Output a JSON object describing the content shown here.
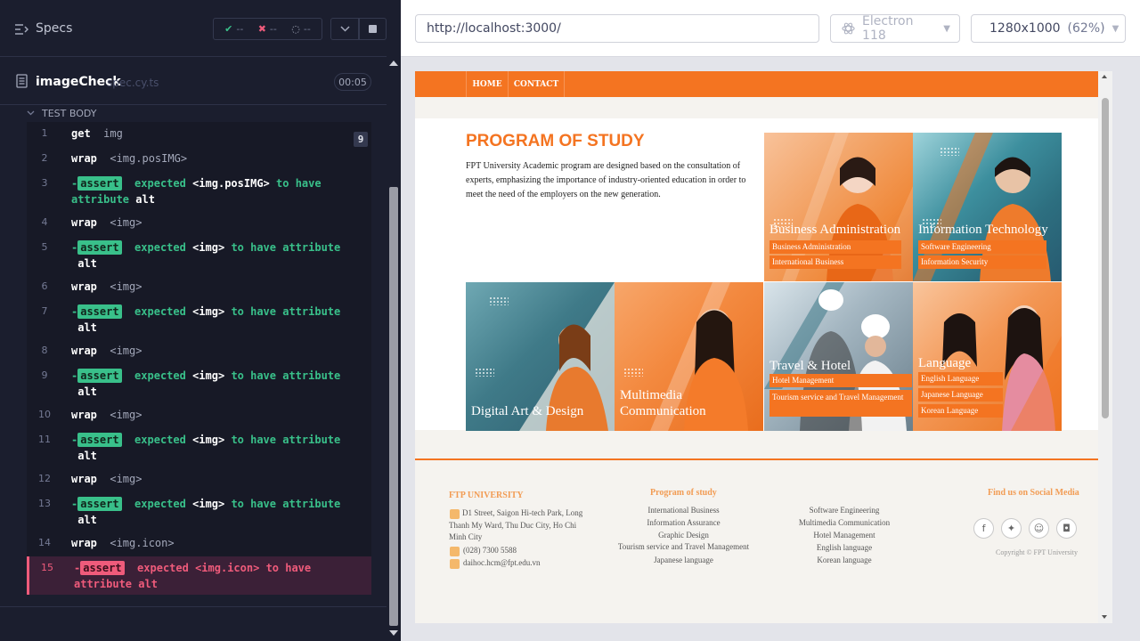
{
  "reporter": {
    "specs_label": "Specs",
    "stats": {
      "passed": "--",
      "failed": "--",
      "pending": "--"
    },
    "file_name": "imageCheck",
    "file_ext": "spec.cy.ts",
    "timer": "00:05",
    "test_body": "TEST BODY",
    "badge": "9",
    "commands": [
      {
        "n": "1",
        "kw": "get",
        "arg": "img"
      },
      {
        "n": "2",
        "kw": "wrap",
        "arg": "<img.posIMG>"
      },
      {
        "n": "3",
        "pill": "assert",
        "pre": "expected",
        "target": "<img.posIMG>",
        "post": "to have attribute",
        "end": "alt"
      },
      {
        "n": "4",
        "kw": "wrap",
        "arg": "<img>"
      },
      {
        "n": "5",
        "pill": "assert",
        "pre": "expected",
        "target": "<img>",
        "post": "to have attribute",
        "end": "alt"
      },
      {
        "n": "6",
        "kw": "wrap",
        "arg": "<img>"
      },
      {
        "n": "7",
        "pill": "assert",
        "pre": "expected",
        "target": "<img>",
        "post": "to have attribute",
        "end": "alt"
      },
      {
        "n": "8",
        "kw": "wrap",
        "arg": "<img>"
      },
      {
        "n": "9",
        "pill": "assert",
        "pre": "expected",
        "target": "<img>",
        "post": "to have attribute",
        "end": "alt"
      },
      {
        "n": "10",
        "kw": "wrap",
        "arg": "<img>"
      },
      {
        "n": "11",
        "pill": "assert",
        "pre": "expected",
        "target": "<img>",
        "post": "to have attribute",
        "end": "alt"
      },
      {
        "n": "12",
        "kw": "wrap",
        "arg": "<img>"
      },
      {
        "n": "13",
        "pill": "assert",
        "pre": "expected",
        "target": "<img>",
        "post": "to have attribute",
        "end": "alt"
      },
      {
        "n": "14",
        "kw": "wrap",
        "arg": "<img.icon>"
      },
      {
        "n": "15",
        "pill": "assert",
        "pre": "expected",
        "target": "<img.icon>",
        "post": "to have",
        "end": "attribute alt"
      }
    ]
  },
  "browser_bar": {
    "url": "http://localhost:3000/",
    "browser": "Electron 118",
    "viewport": "1280x1000",
    "zoom": "(62%)"
  },
  "site": {
    "nav": {
      "home": "HOME",
      "contact": "CONTACT"
    },
    "program_title": "PROGRAM OF STUDY",
    "program_desc": "FPT University Academic program are designed based on the consultation of experts, emphasizing the importance of industry-oriented education in order to meet the need of the employers on the new generation.",
    "tiles": {
      "business": {
        "label": "Business Administration",
        "subs": [
          "Business Administration",
          "International Business"
        ]
      },
      "it": {
        "label": "Information Technology",
        "subs": [
          "Software Engineering",
          "Information Security"
        ]
      },
      "digital": {
        "label": "Digital Art & Design"
      },
      "multimedia": {
        "label1": "Multimedia",
        "label2": "Communication"
      },
      "travel": {
        "label": "Travel & Hotel",
        "subs": [
          "Hotel Management",
          "Tourism service and Travel Management"
        ]
      },
      "language": {
        "label": "Language",
        "subs": [
          "English Language",
          "Japanese Language",
          "Korean Language"
        ]
      }
    },
    "footer": {
      "uni_title": "FTP UNIVERSITY",
      "address": "D1 Street, Saigon Hi-tech Park, Long Thanh My Ward, Thu Duc City, Ho Chi Minh City",
      "phone": "(028) 7300 5588",
      "email": "daihoc.hcm@fpt.edu.vn",
      "programs_title": "Program of study",
      "programs_col1": [
        "International Business",
        "Information Assurance",
        "Graphic Design",
        "Tourism service and Travel Management",
        "Japanese language"
      ],
      "programs_col2": [
        "Software Engineering",
        "Multimedia Communication",
        "Hotel Management",
        "English language",
        "Korean language"
      ],
      "social_title": "Find us on Social Media",
      "copyright": "Copyright © FPT University"
    }
  },
  "colors": {
    "accent": "#f47421",
    "pass": "#39c08a",
    "fail": "#ef5b7b"
  }
}
